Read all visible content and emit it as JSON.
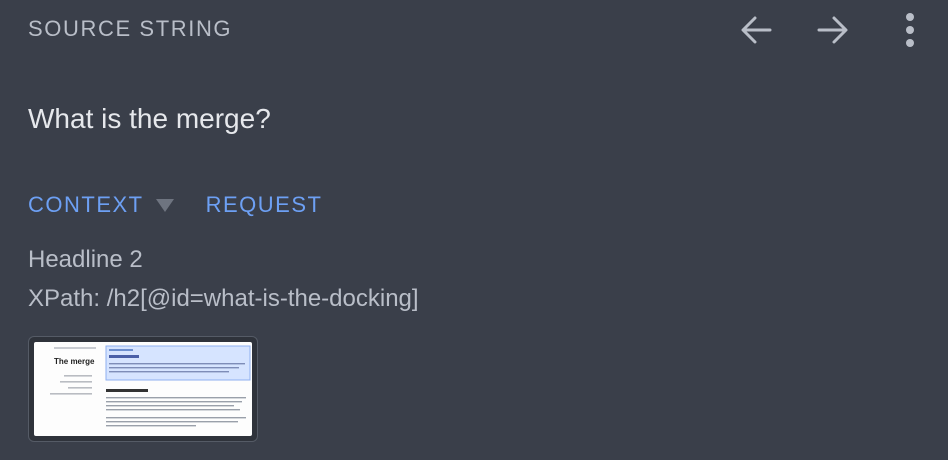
{
  "header": {
    "title": "SOURCE STRING"
  },
  "nav": {
    "prev_icon": "arrow-left-icon",
    "next_icon": "arrow-right-icon",
    "menu_icon": "more-vert-icon"
  },
  "source": {
    "text": "What is the merge?"
  },
  "tabs": {
    "context": "CONTEXT",
    "request": "REQUEST"
  },
  "context": {
    "title": "Headline 2",
    "xpath": "XPath: /h2[@id=what-is-the-docking]"
  },
  "screenshot": {
    "heading": "The merge",
    "sidebar_items": [
      "",
      "",
      "",
      ""
    ],
    "section_label": "",
    "section_heading": "",
    "section2_heading": ""
  },
  "colors": {
    "background": "#3a3f4a",
    "accent": "#6da0f4",
    "muted": "#b9bec8",
    "text": "#e6e8ec"
  }
}
